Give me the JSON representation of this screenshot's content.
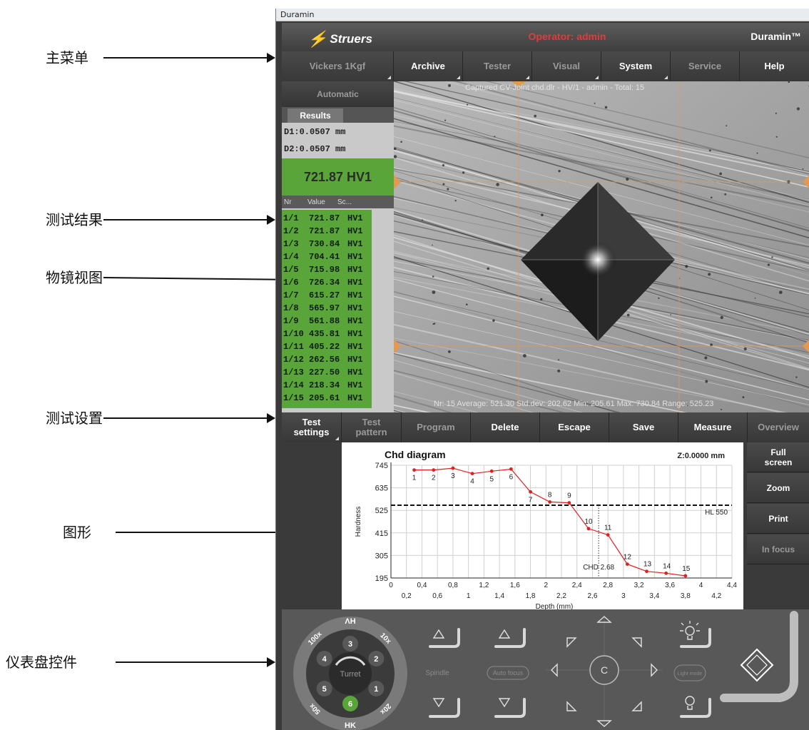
{
  "annotations": [
    {
      "id": "main-menu",
      "label": "主菜单"
    },
    {
      "id": "test-results",
      "label": "测试结果"
    },
    {
      "id": "objective-view",
      "label": "物镜视图"
    },
    {
      "id": "test-settings",
      "label": "测试设置"
    },
    {
      "id": "graphics",
      "label": "图形"
    },
    {
      "id": "dial-controls",
      "label": "仪表盘控件"
    }
  ],
  "window": {
    "title": "Duramin",
    "brand": "Struers",
    "operator": "Operator: admin",
    "product": "Duramin™"
  },
  "menu": [
    {
      "label": "Vickers 1Kgf",
      "dim": true,
      "tri": true
    },
    {
      "label": "Archive",
      "dim": false,
      "tri": true
    },
    {
      "label": "Tester",
      "dim": true,
      "tri": true
    },
    {
      "label": "Visual",
      "dim": true,
      "tri": true
    },
    {
      "label": "System",
      "dim": false,
      "tri": true
    },
    {
      "label": "Service",
      "dim": true,
      "tri": false
    },
    {
      "label": "Help",
      "dim": false,
      "tri": false
    }
  ],
  "results": {
    "mode_label": "Automatic",
    "tab_label": "Results",
    "d1": "D1:0.0507 mm",
    "d2": "D2:0.0507 mm",
    "hardness": "721.87 HV1",
    "columns": [
      "Nr",
      "Value",
      "Sc..."
    ],
    "rows": [
      [
        "1/1",
        "721.87",
        "HV1"
      ],
      [
        "1/2",
        "721.87",
        "HV1"
      ],
      [
        "1/3",
        "730.84",
        "HV1"
      ],
      [
        "1/4",
        "704.41",
        "HV1"
      ],
      [
        "1/5",
        "715.98",
        "HV1"
      ],
      [
        "1/6",
        "726.34",
        "HV1"
      ],
      [
        "1/7",
        "615.27",
        "HV1"
      ],
      [
        "1/8",
        "565.97",
        "HV1"
      ],
      [
        "1/9",
        "561.88",
        "HV1"
      ],
      [
        "1/10",
        "435.81",
        "HV1"
      ],
      [
        "1/11",
        "405.22",
        "HV1"
      ],
      [
        "1/12",
        "262.56",
        "HV1"
      ],
      [
        "1/13",
        "227.50",
        "HV1"
      ],
      [
        "1/14",
        "218.34",
        "HV1"
      ],
      [
        "1/15",
        "205.61",
        "HV1"
      ]
    ]
  },
  "viewer": {
    "header": "Captured     CV-Joint chd.dlr - HV/1 - admin - Total: 15",
    "footer": "Nr: 15    Average: 521.30    Std.dev: 202.62    Min: 205.61    Max: 730.84    Range: 525.23"
  },
  "toolbar": [
    {
      "label": "Test settings",
      "dim": false,
      "tri": true
    },
    {
      "label": "Test pattern",
      "dim": true,
      "tri": false
    },
    {
      "label": "Program",
      "dim": true,
      "tri": false
    },
    {
      "label": "Delete",
      "dim": false,
      "tri": false
    },
    {
      "label": "Escape",
      "dim": false,
      "tri": false
    },
    {
      "label": "Save",
      "dim": false,
      "tri": false
    },
    {
      "label": "Measure",
      "dim": false,
      "tri": false
    },
    {
      "label": "Overview",
      "dim": true,
      "tri": false
    }
  ],
  "side_buttons": [
    {
      "label": "Full screen",
      "dim": false
    },
    {
      "label": "Zoom",
      "dim": false
    },
    {
      "label": "Print",
      "dim": false
    },
    {
      "label": "In focus",
      "dim": true
    }
  ],
  "chart_data": {
    "type": "line",
    "title": "Chd diagram",
    "z_readout": "Z:0.0000 mm",
    "xlabel": "Depth (mm)",
    "ylabel": "Hardness",
    "xlim": [
      0,
      4.4
    ],
    "ylim": [
      195,
      745
    ],
    "yticks": [
      195,
      305,
      415,
      525,
      635,
      745
    ],
    "xticks_top": [
      "0",
      "0,4",
      "0,8",
      "1,2",
      "1,6",
      "2",
      "2,4",
      "2,8",
      "3,2",
      "3,6",
      "4",
      "4,4"
    ],
    "xticks_bottom": [
      "0,2",
      "0,6",
      "1",
      "1,4",
      "1,8",
      "2,2",
      "2,6",
      "3",
      "3,4",
      "3,8",
      "4,2"
    ],
    "series": [
      {
        "color": "#e02020",
        "x": [
          0.3,
          0.55,
          0.8,
          1.05,
          1.3,
          1.55,
          1.8,
          2.05,
          2.3,
          2.55,
          2.8,
          3.05,
          3.3,
          3.55,
          3.8
        ],
        "y": [
          721.87,
          721.87,
          730.84,
          704.41,
          715.98,
          726.34,
          615.27,
          565.97,
          561.88,
          435.81,
          405.22,
          262.56,
          227.5,
          218.34,
          205.61
        ],
        "labels": [
          "1",
          "2",
          "3",
          "4",
          "5",
          "6",
          "7",
          "8",
          "9",
          "10",
          "11",
          "12",
          "13",
          "14",
          "15"
        ]
      }
    ],
    "threshold": {
      "value": 550,
      "label": "HL 550"
    },
    "chd": {
      "x": 2.68,
      "label": "CHD 2.68"
    }
  },
  "dial": {
    "top_label": "ΛH",
    "bottom_label": "HK",
    "center_label": "Turret",
    "positions": [
      "1",
      "2",
      "3",
      "4",
      "5",
      "6"
    ],
    "active_position": "6",
    "magnifications": [
      "10x",
      "20x",
      "50x",
      "100x"
    ]
  },
  "controls": {
    "spindle_label": "Spindle",
    "autofocus_label": "Auto focus",
    "center_label": "C",
    "light_label": "Light mode"
  }
}
